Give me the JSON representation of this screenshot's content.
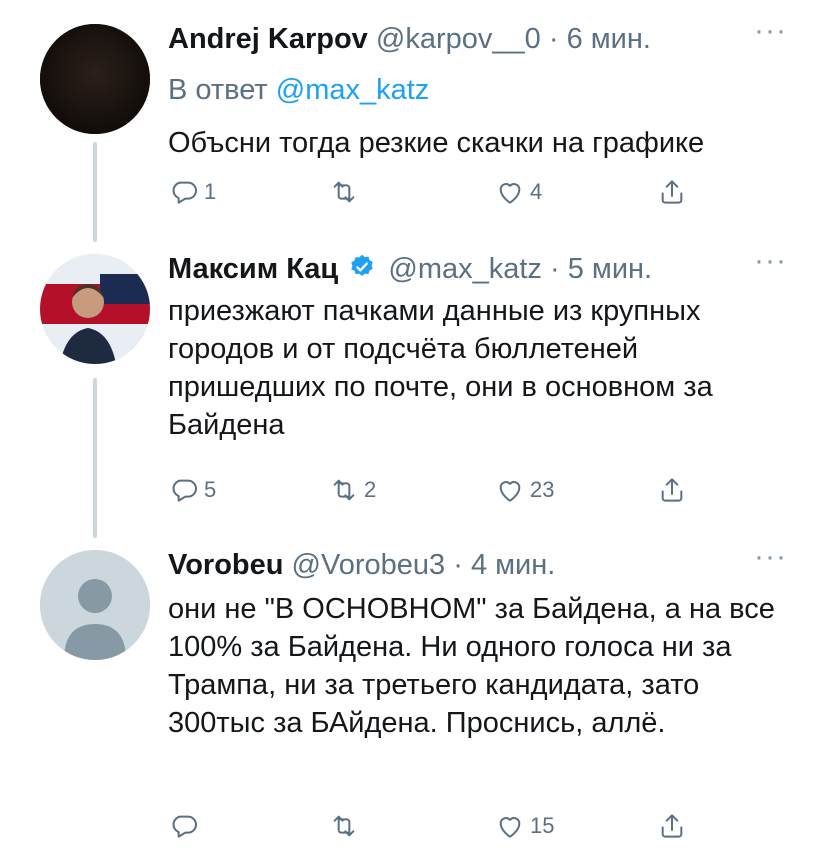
{
  "tweets": [
    {
      "name": "Andrej Karpov",
      "handle": "@karpov__0",
      "separator": "·",
      "time": "6 мин.",
      "reply_label": "В ответ",
      "reply_mention": "@max_katz",
      "text": "Объсни тогда резкие скачки на графике",
      "replies": "1",
      "retweets": "",
      "likes": "4",
      "verified": false
    },
    {
      "name": "Максим Кац",
      "handle": "@max_katz",
      "separator": "·",
      "time": "5 мин.",
      "text": "приезжают пачками данные из крупных городов и от подсчёта бюллетеней пришедших по почте, они в основном за Байдена",
      "replies": "5",
      "retweets": "2",
      "likes": "23",
      "verified": true
    },
    {
      "name": "Vorobeu",
      "handle": "@Vorobeu3",
      "separator": "·",
      "time": "4 мин.",
      "text": "они не \"В ОСНОВНОМ\" за Байдена, а на все 100% за Байдена. Ни одного голоса ни за Трампа, ни за третьего кандидата, зато 300тыс за БАйдена. Проснись, аллё.",
      "replies": "",
      "retweets": "",
      "likes": "15",
      "verified": false
    }
  ],
  "more_glyph": "···",
  "colors": {
    "accent": "#1da1f2",
    "secondary": "#5b7083",
    "thread": "#ccd6dd"
  }
}
